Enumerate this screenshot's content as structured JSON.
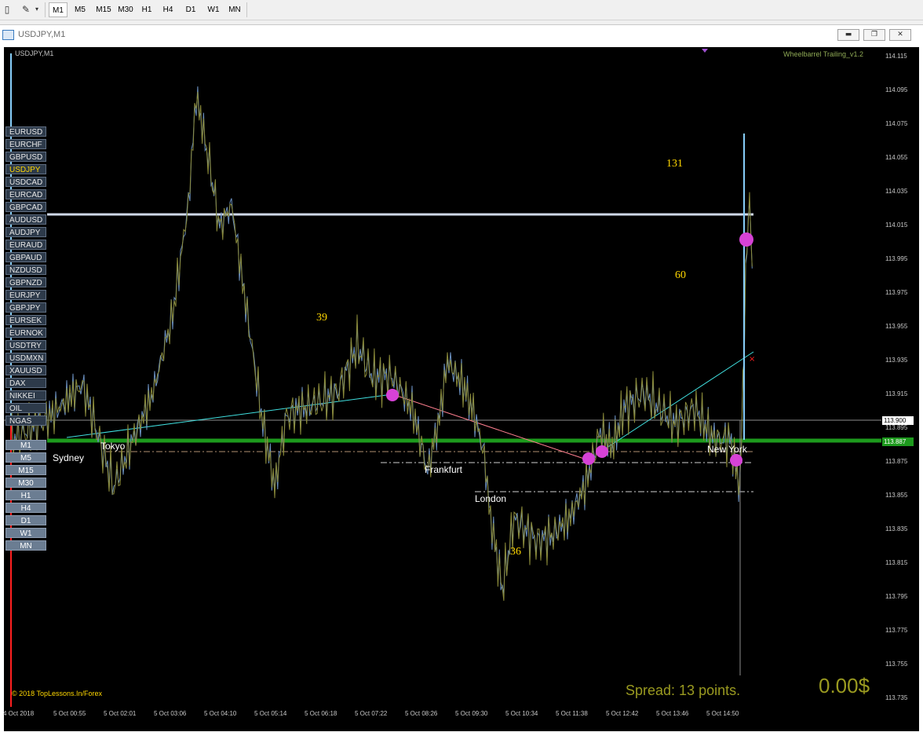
{
  "toolbar": {
    "timeframes": [
      "M1",
      "M5",
      "M15",
      "M30",
      "H1",
      "H4",
      "D1",
      "W1",
      "MN"
    ],
    "active_timeframe": "M1"
  },
  "window": {
    "title": "USDJPY,M1",
    "buttons": [
      "minimize",
      "restore",
      "close"
    ]
  },
  "chart": {
    "label": "USDJPY,M1",
    "indicator": "Wheelbarrel Trailing_v1.2",
    "copyright": "© 2018 TopLessons.In/Forex",
    "spread_text": "Spread: 13 points.",
    "profit_text": "0.00$",
    "current_price": "113.887",
    "line_price": "113.900"
  },
  "symbols": [
    "EURUSD",
    "EURCHF",
    "GBPUSD",
    "USDJPY",
    "USDCAD",
    "EURCAD",
    "GBPCAD",
    "AUDUSD",
    "AUDJPY",
    "EURAUD",
    "GBPAUD",
    "NZDUSD",
    "GBPNZD",
    "EURJPY",
    "GBPJPY",
    "EURSEK",
    "EURNOK",
    "USDTRY",
    "USDMXN",
    "XAUUSD",
    "DAX",
    "NIKKEI",
    "OIL",
    "NGAS"
  ],
  "active_symbol": "USDJPY",
  "timeframe_buttons": [
    "M1",
    "M5",
    "M15",
    "M30",
    "H1",
    "H4",
    "D1",
    "W1",
    "MN"
  ],
  "sessions": {
    "sydney": "Sydney",
    "tokyo": "Tokyo",
    "frankfurt": "Frankfurt",
    "london": "London",
    "new_york": "New York"
  },
  "counts": {
    "c131": "131",
    "c60": "60",
    "c39": "39",
    "c36": "36"
  },
  "colors": {
    "chart_bg": "#000000",
    "candle": "#6a8fbf",
    "accent_yellow": "#ffd700",
    "green_line": "#0f8f0f",
    "magenta": "#d642d6"
  },
  "chart_data": {
    "type": "line",
    "symbol": "USDJPY",
    "timeframe": "M1",
    "x_ticks": [
      "4 Oct 2018",
      "5 Oct 00:55",
      "5 Oct 02:01",
      "5 Oct 03:06",
      "5 Oct 04:10",
      "5 Oct 05:14",
      "5 Oct 06:18",
      "5 Oct 07:22",
      "5 Oct 08:26",
      "5 Oct 09:30",
      "5 Oct 10:34",
      "5 Oct 11:38",
      "5 Oct 12:42",
      "5 Oct 13:46",
      "5 Oct 14:50"
    ],
    "y_ticks": [
      "114.115",
      "114.095",
      "114.075",
      "114.055",
      "114.035",
      "114.015",
      "113.995",
      "113.975",
      "113.955",
      "113.935",
      "113.915",
      "113.895",
      "113.875",
      "113.855",
      "113.835",
      "113.815",
      "113.795",
      "113.775",
      "113.755",
      "113.735"
    ],
    "ylim": [
      113.735,
      114.115
    ],
    "current_price": 113.887,
    "horizontal_line": 113.9
  }
}
